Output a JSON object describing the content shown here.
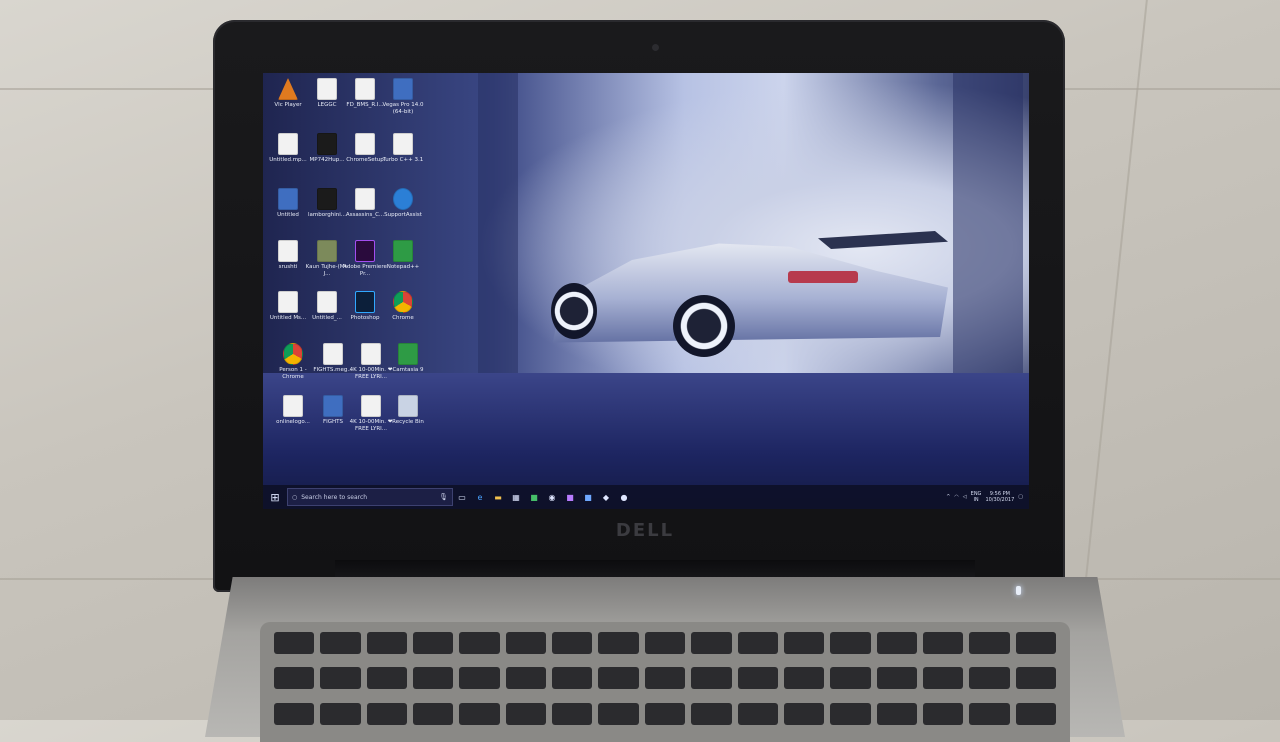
{
  "brand": "DELL",
  "desktop_icons": [
    {
      "label": "Vlc Player"
    },
    {
      "label": "LEGGC"
    },
    {
      "label": "FD_BMS_R.I..."
    },
    {
      "label": "Vegas Pro 14.0 (64-bit)"
    },
    {
      "label": "Untitled.mp..."
    },
    {
      "label": "MP742Hup..."
    },
    {
      "label": "ChromeSetup"
    },
    {
      "label": "Turbo C++ 3.1"
    },
    {
      "label": "Untitled"
    },
    {
      "label": "lamborghini..."
    },
    {
      "label": "Assassins_C..."
    },
    {
      "label": "SupportAssist"
    },
    {
      "label": "srushti"
    },
    {
      "label": "Kaun Tujhe-(Mr-J..."
    },
    {
      "label": "Adobe Premiere Pr..."
    },
    {
      "label": "Notepad++"
    },
    {
      "label": "Untitled Ms..."
    },
    {
      "label": "Untitled_..."
    },
    {
      "label": "Photoshop"
    },
    {
      "label": "Chrome"
    },
    {
      "label": "Person 1 - Chrome"
    },
    {
      "label": "FIGHTS.meg..."
    },
    {
      "label": "4K 10-00Min. ❤ FREE LYRI..."
    },
    {
      "label": "Camtasia 9"
    },
    {
      "label": "onlinelogo..."
    },
    {
      "label": "FIGHTS"
    },
    {
      "label": "4K 10-00Min. ❤ FREE LYRI..."
    },
    {
      "label": "Recycle Bin"
    }
  ],
  "taskbar": {
    "search_placeholder": "Search here to search",
    "language": "ENG",
    "region": "IN",
    "time": "9:56 PM",
    "date": "10/30/2017"
  },
  "icons": {
    "start": "windows-start-icon",
    "mic": "microphone-icon",
    "task_view": "task-view-icon",
    "edge": "edge-browser-icon",
    "explorer": "file-explorer-icon",
    "store": "store-icon",
    "notification": "action-center-icon"
  }
}
